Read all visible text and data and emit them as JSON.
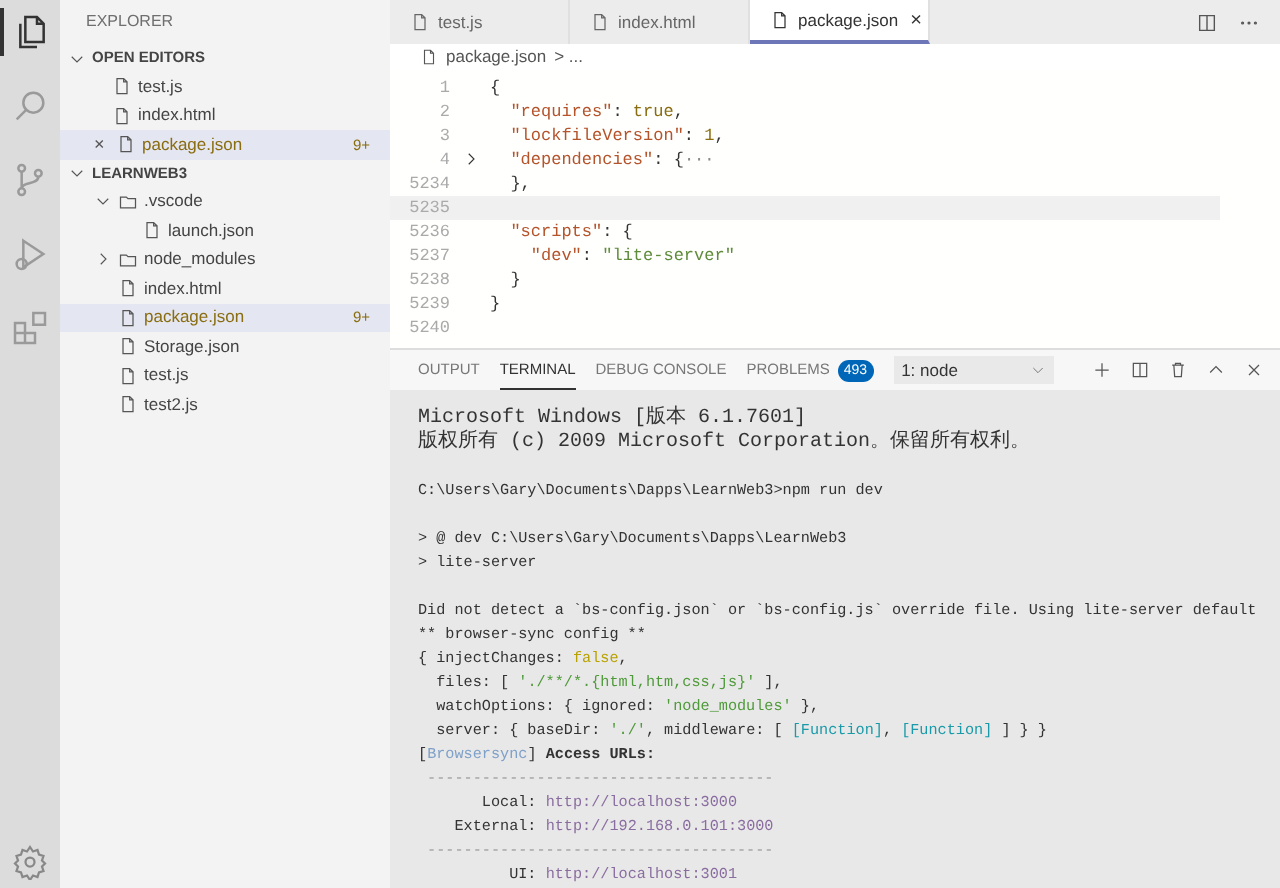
{
  "activity_bar": [
    {
      "kind": "files",
      "selected": true
    },
    {
      "kind": "search",
      "selected": false
    },
    {
      "kind": "source-control",
      "selected": false
    },
    {
      "kind": "run",
      "selected": false
    },
    {
      "kind": "extensions",
      "selected": false
    }
  ],
  "sidebar": {
    "title": "EXPLORER",
    "open_editors": {
      "title": "OPEN EDITORS",
      "expanded": true,
      "items": [
        {
          "label": "test.js",
          "selected": false,
          "modified": false
        },
        {
          "label": "index.html",
          "selected": false,
          "modified": false
        },
        {
          "label": "package.json",
          "selected": true,
          "modified": true,
          "close": "×",
          "badge": "9+"
        }
      ]
    },
    "folder": {
      "title": "LEARNWEB3",
      "expanded": true,
      "items": [
        {
          "label": ".vscode",
          "kind": "folder",
          "expanded": true,
          "children": [
            {
              "label": "launch.json",
              "kind": "file",
              "selected": false,
              "modified": false
            }
          ]
        },
        {
          "label": "node_modules",
          "kind": "folder",
          "expanded": false
        },
        {
          "label": "index.html",
          "kind": "file",
          "selected": false,
          "modified": false
        },
        {
          "label": "package.json",
          "kind": "file",
          "selected": true,
          "modified": true,
          "badge": "9+"
        },
        {
          "label": "Storage.json",
          "kind": "file",
          "selected": false,
          "modified": false
        },
        {
          "label": "test.js",
          "kind": "file",
          "selected": false,
          "modified": false
        },
        {
          "label": "test2.js",
          "kind": "file",
          "selected": false,
          "modified": false
        }
      ]
    }
  },
  "tabs": [
    {
      "label": "test.js",
      "selected": false
    },
    {
      "label": "index.html",
      "selected": false
    },
    {
      "label": "package.json",
      "selected": true,
      "close": "×"
    }
  ],
  "breadcrumb": {
    "file": "package.json",
    "rest": "> ..."
  },
  "code_lines": [
    {
      "number": "1",
      "tokens": [
        {
          "text": "{",
          "kind": "punct"
        }
      ]
    },
    {
      "number": "2",
      "tokens": [
        {
          "text": "  \"requires\"",
          "kind": "key"
        },
        {
          "text": ": ",
          "kind": "punct"
        },
        {
          "text": "true",
          "kind": "value"
        },
        {
          "text": ",",
          "kind": "punct"
        }
      ]
    },
    {
      "number": "3",
      "tokens": [
        {
          "text": "  \"lockfileVersion\"",
          "kind": "key"
        },
        {
          "text": ": ",
          "kind": "punct"
        },
        {
          "text": "1",
          "kind": "value"
        },
        {
          "text": ",",
          "kind": "punct"
        }
      ]
    },
    {
      "number": "4",
      "folded": true,
      "tokens": [
        {
          "text": "  \"dependencies\"",
          "kind": "key"
        },
        {
          "text": ": {",
          "kind": "punct"
        },
        {
          "text": "···",
          "kind": "fold"
        }
      ]
    },
    {
      "number": "5234",
      "tokens": [
        {
          "text": "  },",
          "kind": "punct"
        }
      ]
    },
    {
      "number": "5235",
      "current": true
    },
    {
      "number": "5236",
      "tokens": [
        {
          "text": "  \"scripts\"",
          "kind": "key"
        },
        {
          "text": ": {",
          "kind": "punct"
        }
      ]
    },
    {
      "number": "5237",
      "tokens": [
        {
          "text": "    \"dev\"",
          "kind": "key"
        },
        {
          "text": ": ",
          "kind": "punct"
        },
        {
          "text": "\"lite-server\"",
          "kind": "string"
        }
      ]
    },
    {
      "number": "5238",
      "tokens": [
        {
          "text": "  }",
          "kind": "punct"
        }
      ]
    },
    {
      "number": "5239",
      "tokens": [
        {
          "text": "}",
          "kind": "punct"
        }
      ]
    },
    {
      "number": "5240"
    }
  ],
  "panel": {
    "tabs": [
      {
        "label": "OUTPUT",
        "selected": false
      },
      {
        "label": "TERMINAL",
        "selected": true
      },
      {
        "label": "DEBUG CONSOLE",
        "selected": false
      },
      {
        "label": "PROBLEMS",
        "selected": false,
        "badge": "493"
      }
    ],
    "terminal_select": "1: node",
    "terminal_lines": [
      [
        {
          "text": "Microsoft Windows [版本 6.1.7601]",
          "kind": "plain"
        }
      ],
      [
        {
          "text": "版权所有 (c) 2009 Microsoft Corporation。保留所有权利。",
          "kind": "plain"
        }
      ],
      {
        "kind": "blank"
      },
      [
        {
          "text": "C:\\Users\\Gary\\Documents\\Dapps\\LearnWeb3>npm run dev",
          "kind": "plain"
        }
      ],
      {
        "kind": "blank"
      },
      [
        {
          "text": "> @ dev C:\\Users\\Gary\\Documents\\Dapps\\LearnWeb3",
          "kind": "plain"
        }
      ],
      [
        {
          "text": "> lite-server",
          "kind": "plain"
        }
      ],
      {
        "kind": "blank"
      },
      [
        {
          "text": "Did not detect a `bs-config.json` or `bs-config.js` override file. Using lite-server default",
          "kind": "plain"
        }
      ],
      [
        {
          "text": "** browser-sync config **",
          "kind": "plain"
        }
      ],
      [
        {
          "text": "{ injectChanges: ",
          "kind": "plain"
        },
        {
          "text": "false",
          "kind": "keyword"
        },
        {
          "text": ",",
          "kind": "plain"
        }
      ],
      [
        {
          "text": "  files: [ ",
          "kind": "plain"
        },
        {
          "text": "'./**/*.{html,htm,css,js}'",
          "kind": "string"
        },
        {
          "text": " ],",
          "kind": "plain"
        }
      ],
      [
        {
          "text": "  watchOptions: { ignored: ",
          "kind": "plain"
        },
        {
          "text": "'node_modules'",
          "kind": "string"
        },
        {
          "text": " },",
          "kind": "plain"
        }
      ],
      [
        {
          "text": "  server: { baseDir: ",
          "kind": "plain"
        },
        {
          "text": "'./'",
          "kind": "string"
        },
        {
          "text": ", middleware: [ ",
          "kind": "plain"
        },
        {
          "text": "[Function]",
          "kind": "special"
        },
        {
          "text": ", ",
          "kind": "plain"
        },
        {
          "text": "[Function]",
          "kind": "special"
        },
        {
          "text": " ] } }",
          "kind": "plain"
        }
      ],
      [
        {
          "text": "[",
          "kind": "plain"
        },
        {
          "text": "Browsersync",
          "kind": "tag"
        },
        {
          "text": "] ",
          "kind": "plain"
        },
        {
          "text": "Access URLs:",
          "kind": "bold"
        }
      ],
      [
        {
          "text": " --------------------------------------",
          "kind": "dim"
        }
      ],
      [
        {
          "text": "       Local: ",
          "kind": "plain"
        },
        {
          "text": "http://localhost:3000",
          "kind": "url"
        }
      ],
      [
        {
          "text": "    External: ",
          "kind": "plain"
        },
        {
          "text": "http://192.168.0.101:3000",
          "kind": "url"
        }
      ],
      [
        {
          "text": " --------------------------------------",
          "kind": "dim"
        }
      ],
      [
        {
          "text": "          UI: ",
          "kind": "plain"
        },
        {
          "text": "http://localhost:3001",
          "kind": "url"
        }
      ]
    ]
  }
}
